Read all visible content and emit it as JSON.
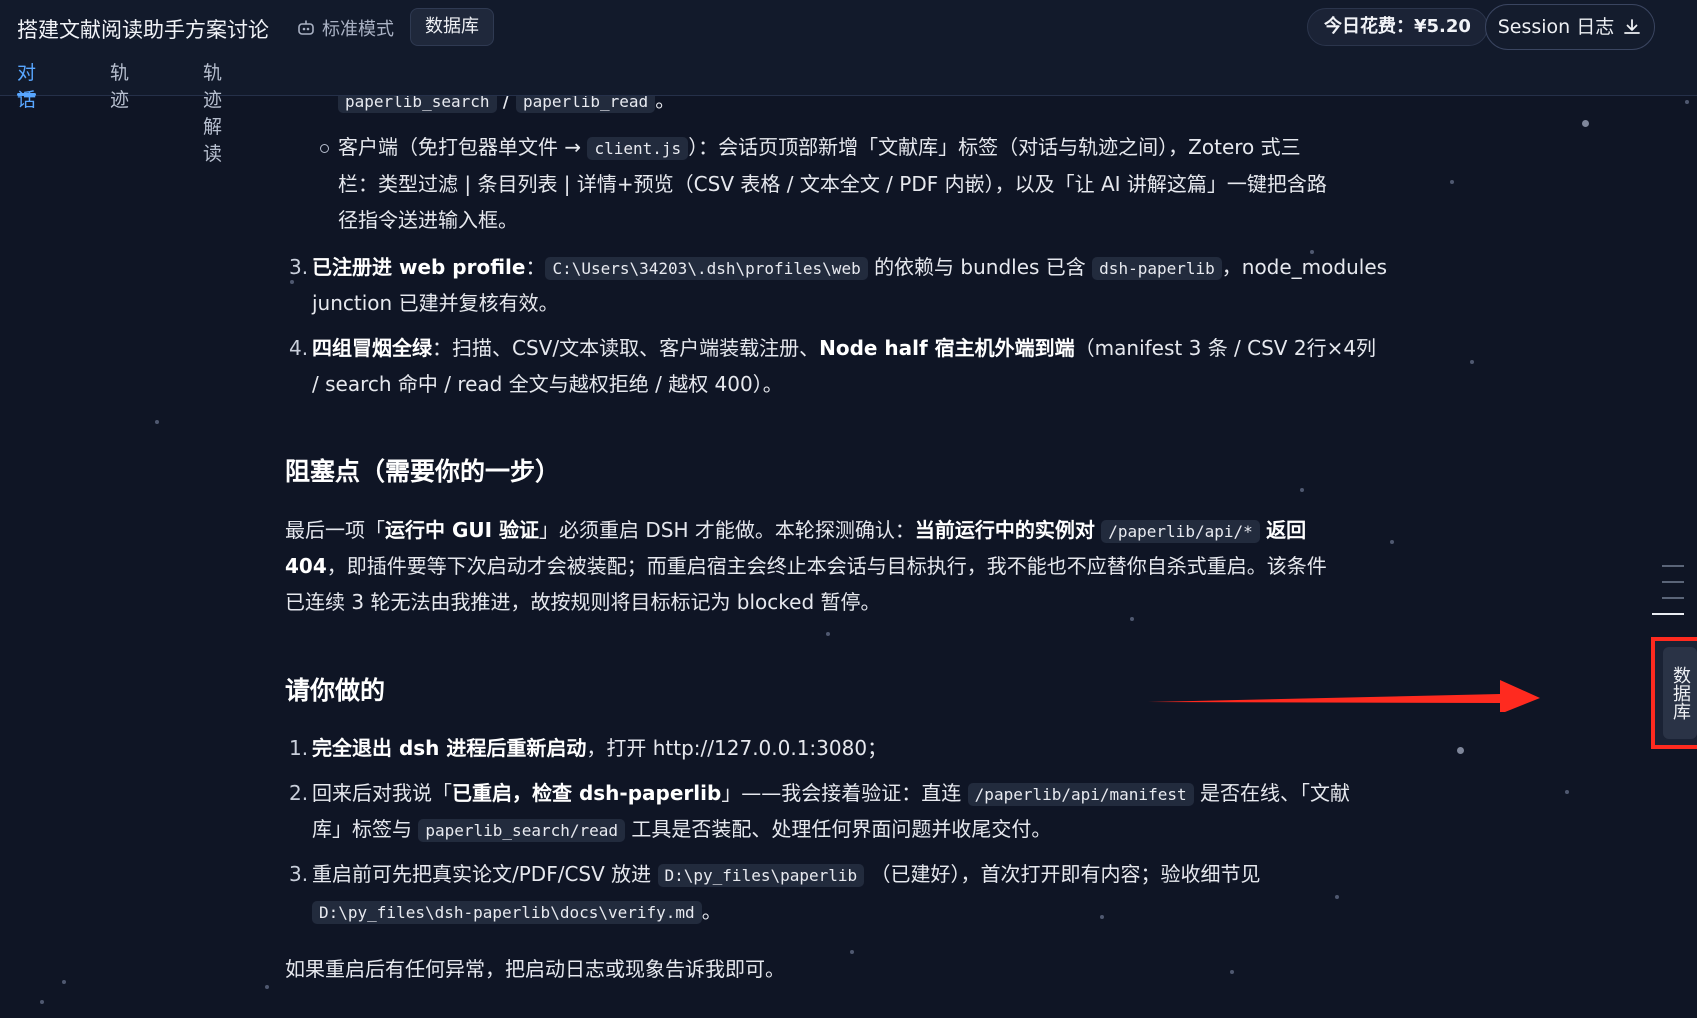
{
  "header": {
    "title": "搭建文献阅读助手方案讨论",
    "mode_label": "标准模式",
    "database_button": "数据库",
    "cost_label": "今日花费：¥5.20",
    "session_button": "Session 日志"
  },
  "tabs": [
    {
      "label": "对话",
      "active": true
    },
    {
      "label": "轨迹",
      "active": false
    },
    {
      "label": "轨迹解读",
      "active": false
    }
  ],
  "content": {
    "top_line": {
      "code1": "paperlib_search",
      "sep": " / ",
      "code2": "paperlib_read",
      "end": "。"
    },
    "sub_item": {
      "prefix": "客户端（免打包器单文件 →",
      "code": "client.js",
      "line1_rest": "）：会话页顶部新增「文献库」标签（对话与轨迹之间），Zotero 式三",
      "line2": "栏：类型过滤 | 条目列表 | 详情+预览（CSV 表格 / 文本全文 / PDF 内嵌），以及「让 AI 讲解这篇」一键把含路",
      "line3": "径指令送进输入框。"
    },
    "item3": {
      "num": "3.",
      "bold": "已注册进 web profile",
      "colon": "：",
      "code": "C:\\Users\\34203\\.dsh\\profiles\\web",
      "mid": "的依赖与 bundles 已含",
      "code2": "dsh-paperlib",
      "rest": "，node_modules",
      "line2": "junction 已建并复核有效。"
    },
    "item4": {
      "num": "4.",
      "bold1": "四组冒烟全绿",
      "text1": "：扫描、CSV/文本读取、客户端装载注册、",
      "bold2": "Node half 宿主机外端到端",
      "text2": "（manifest 3 条 / CSV 2行×4列",
      "line2": "/ search 命中 / read 全文与越权拒绝 / 越权 400）。"
    },
    "blocker": {
      "heading": "阻塞点（需要你的一步）",
      "t1": "最后一项「",
      "b1": "运行中 GUI 验证",
      "t2": "」必须重启 DSH 才能做。本轮探测确认：",
      "b2": "当前运行中的实例对",
      "code": "/paperlib/api/*",
      "b3": "返回",
      "b4": "404",
      "line2": "，即插件要等下次启动才会被装配；而重启宿主会终止本会话与目标执行，我不能也不应替你自杀式重启。该条件",
      "line3": "已连续 3 轮无法由我推进，故按规则将目标标记为 blocked 暂停。"
    },
    "todo": {
      "heading": "请你做的",
      "step1": {
        "num": "1.",
        "bold": "完全退出 dsh 进程后重新启动",
        "rest": "，打开 http://127.0.0.1:3080；"
      },
      "step2": {
        "num": "2.",
        "t1": "回来后对我说「",
        "bold": "已重启，检查 dsh-paperlib",
        "t2": "」——我会接着验证：直连",
        "code": "/paperlib/api/manifest",
        "t3": "是否在线、「文献",
        "l2a": "库」标签与",
        "code2": "paperlib_search/read",
        "l2b": "工具是否装配、处理任何界面问题并收尾交付。"
      },
      "step3": {
        "num": "3.",
        "t1": "重启前可先把真实论文/PDF/CSV 放进",
        "code": "D:\\py_files\\paperlib",
        "t2": "（已建好），首次打开即有内容；验收细节见",
        "code2": "D:\\py_files\\dsh-paperlib\\docs\\verify.md",
        "t3": "。"
      }
    },
    "closing": "如果重启后有任何异常，把启动日志或现象告诉我即可。"
  },
  "side_tab": {
    "label": "数据库"
  },
  "colors": {
    "background": "#0f1525",
    "accent": "#58a6ff",
    "highlight_box": "#ff2a1f",
    "arrow": "#ff2a1f"
  }
}
